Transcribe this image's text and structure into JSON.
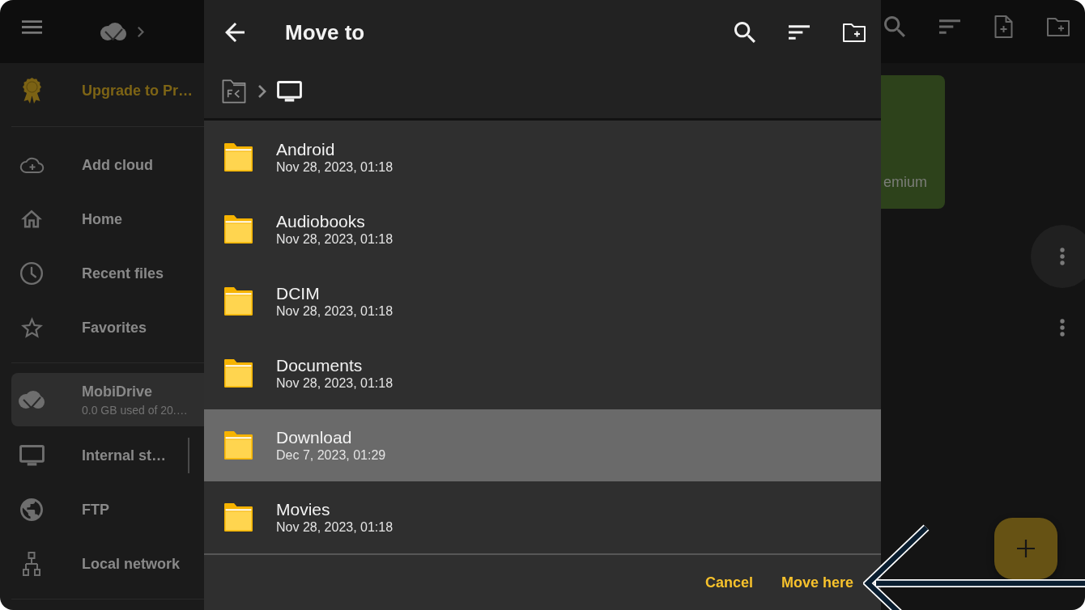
{
  "sidebar": {
    "upgrade": {
      "label": "Upgrade to Pr…"
    },
    "places": [
      {
        "label": "Add cloud",
        "selected": false
      },
      {
        "label": "Home",
        "selected": false
      },
      {
        "label": "Recent files",
        "selected": false
      },
      {
        "label": "Favorites",
        "selected": false
      }
    ],
    "storages": [
      {
        "kind": "account",
        "label": "MobiDrive",
        "detail": "0.0 GB used of 20.…",
        "selected": true
      },
      {
        "kind": "expandable",
        "label": "Internal st…",
        "selected": false
      },
      {
        "kind": "plain",
        "label": "FTP",
        "selected": false
      },
      {
        "kind": "plain",
        "label": "Local network",
        "selected": false
      }
    ]
  },
  "content": {
    "banner": {
      "text": "emium"
    }
  },
  "dialog": {
    "title": "Move to",
    "folders": [
      {
        "name": "Android",
        "modified": "Nov 28, 2023, 01:18",
        "selected": false
      },
      {
        "name": "Audiobooks",
        "modified": "Nov 28, 2023, 01:18",
        "selected": false
      },
      {
        "name": "DCIM",
        "modified": "Nov 28, 2023, 01:18",
        "selected": false
      },
      {
        "name": "Documents",
        "modified": "Nov 28, 2023, 01:18",
        "selected": false
      },
      {
        "name": "Download",
        "modified": "Dec 7, 2023, 01:29",
        "selected": true
      },
      {
        "name": "Movies",
        "modified": "Nov 28, 2023, 01:18",
        "selected": false
      }
    ],
    "actions": [
      "Cancel",
      "Move here"
    ]
  }
}
